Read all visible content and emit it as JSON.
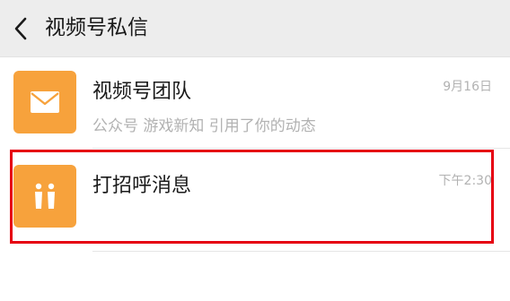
{
  "header": {
    "title": "视频号私信",
    "back_icon": "chevron-left-icon"
  },
  "conversations": [
    {
      "name": "视频号团队",
      "preview": "公众号 游戏新知 引用了你的动态",
      "time": "9月16日",
      "icon": "envelope-icon",
      "avatar_color": "#f7a23c"
    },
    {
      "name": "打招呼消息",
      "preview": "",
      "time": "下午2:30",
      "icon": "greeting-people-icon",
      "avatar_color": "#f7a23c",
      "highlighted": true,
      "highlight_color": "#e60012"
    }
  ]
}
